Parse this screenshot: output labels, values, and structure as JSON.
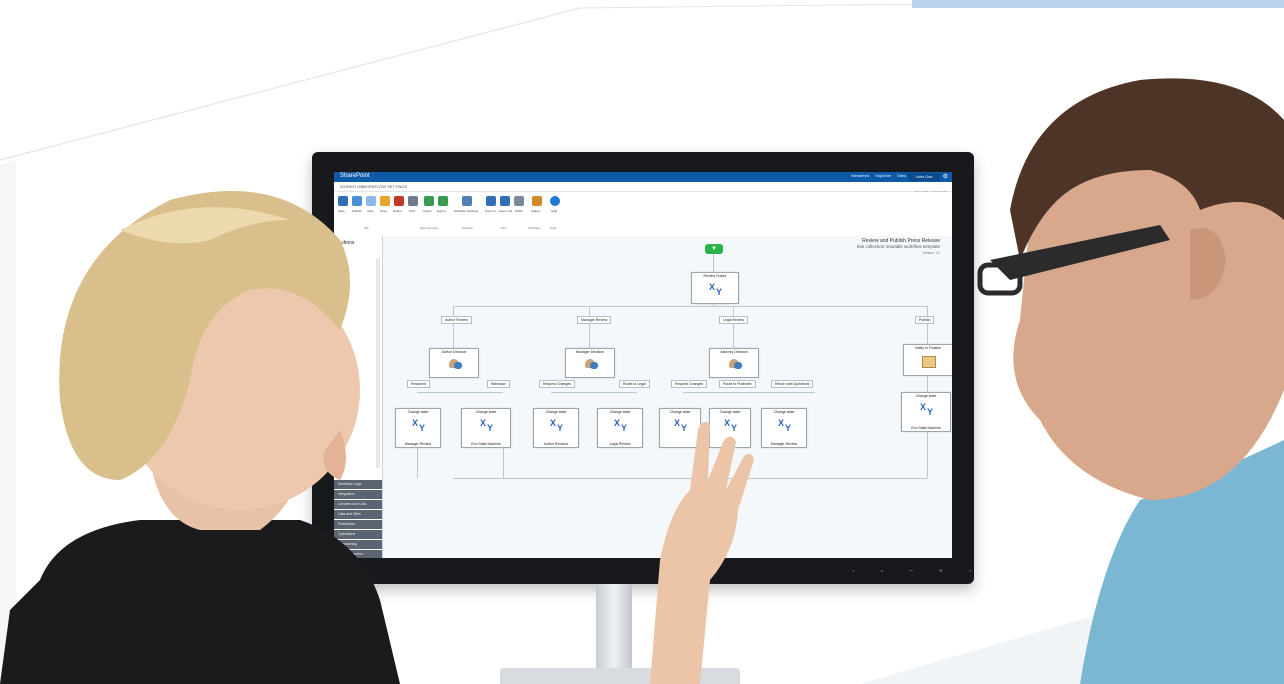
{
  "colors": {
    "suitebar": "#0f5aa8",
    "start": "#2bb34a",
    "accent_band": "#b9d3ec",
    "monitor_frame": "#17191c"
  },
  "app": {
    "brand": "SharePoint",
    "suite_links": [
      "Newsfeed",
      "SkyDrive",
      "Sites"
    ],
    "user": "John Doe",
    "tabs": [
      "WORKFLOW",
      "WORKFLOW SETTINGS"
    ],
    "share": "SHARE",
    "focus": "FOCUS"
  },
  "ribbon": {
    "buttons": [
      "Save",
      "Publish",
      "View",
      "Open",
      "Delete",
      "Print",
      "Import",
      "Export",
      "Workflow Settings",
      "Zoom In",
      "Zoom Out",
      "100%",
      "Gallery",
      "Help"
    ],
    "groups": [
      "File",
      "Export/Import",
      "Settings",
      "View",
      "Workflow",
      "Help"
    ]
  },
  "left_panel": {
    "title": "Actions",
    "categories": [
      "Workflow Logic",
      "Integration",
      "Libraries and Lists",
      "Lists and Sites",
      "Publication",
      "Operations",
      "Provisioning",
      "User Interaction"
    ]
  },
  "workflow": {
    "title": "Review and Publish Press Release",
    "subtitle": "Site collection reusable workflow template",
    "version": "Version 1.0",
    "root": {
      "label": "Review Output"
    },
    "branches": [
      "Author Review",
      "Manager Review",
      "Legal Review",
      "Publish"
    ],
    "decisions": [
      "Author Decision",
      "Manager Decision",
      "Attorney Decision"
    ],
    "notify": "Notify to Finalize",
    "outcomes": [
      "Resubmit",
      "Withdraw",
      "Request Changes",
      "Route to Legal",
      "Request Changes",
      "Route to Publisher",
      "Return with Questions"
    ],
    "change_state_label": "Change state",
    "change_state_nodes": [
      "Manager Review",
      "End State Machine",
      "Author Revision",
      "Legal Review",
      "",
      "",
      "Manager Review"
    ],
    "final_node_label": "Change state",
    "final_node_foot": "End State Machine"
  }
}
